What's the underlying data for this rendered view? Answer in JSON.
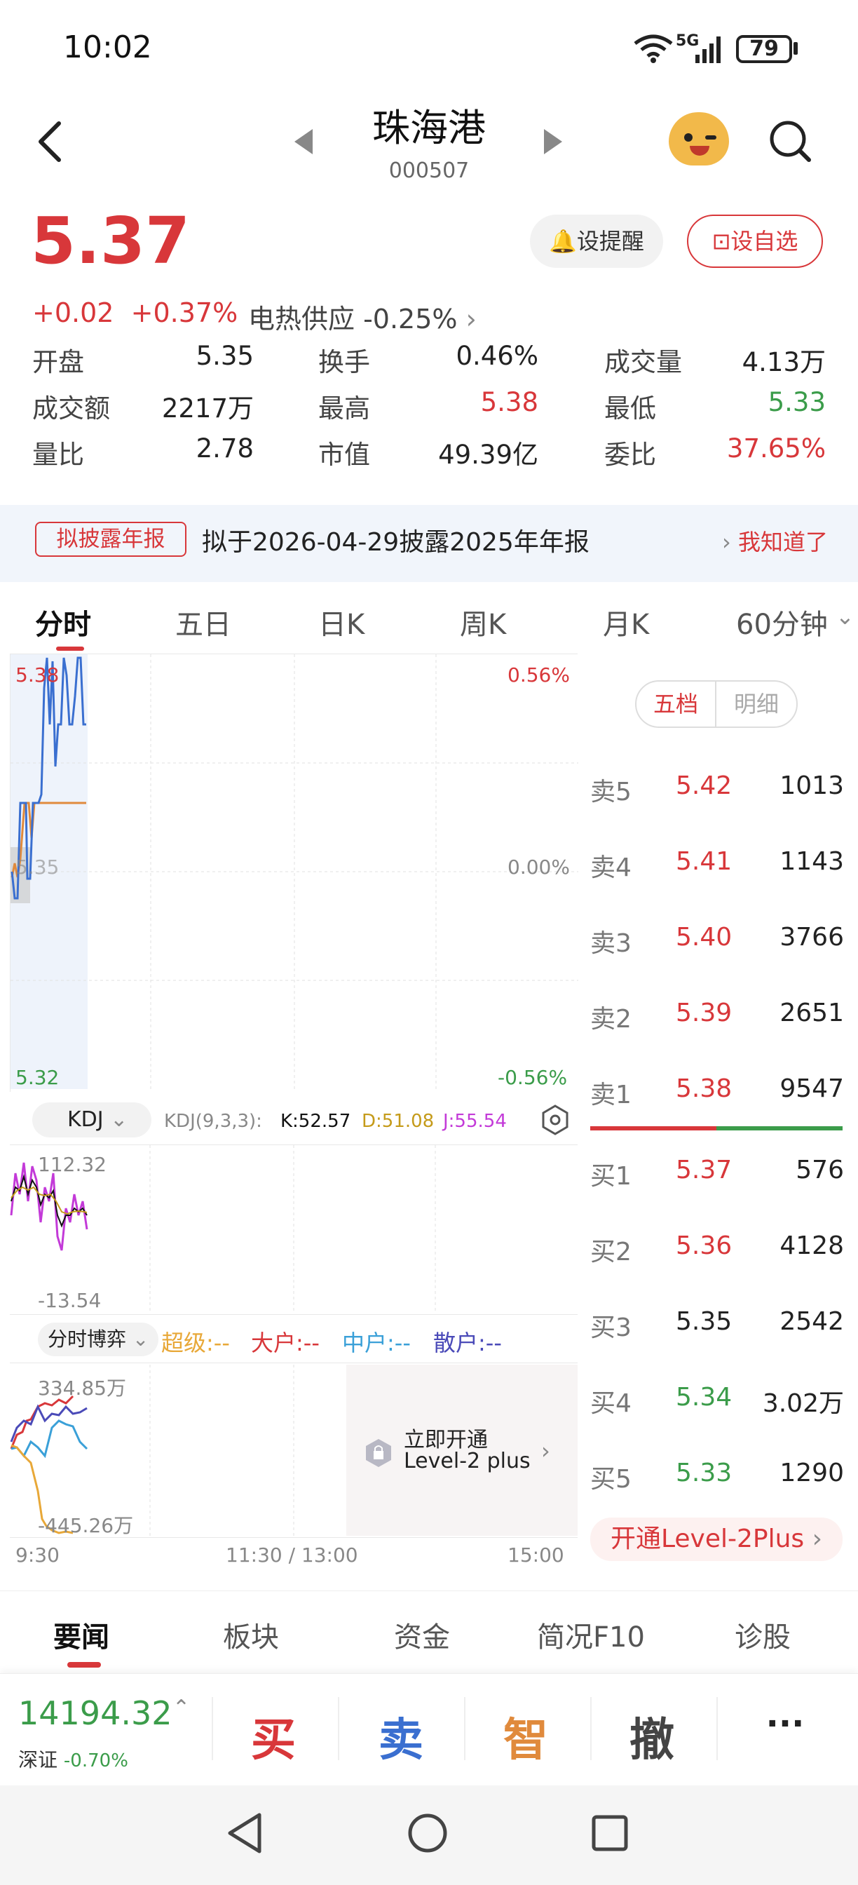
{
  "status": {
    "time": "10:02",
    "network": "5G",
    "battery": "79"
  },
  "header": {
    "name": "珠海港",
    "code": "000507"
  },
  "price": {
    "last": "5.37",
    "change": "+0.02",
    "change_pct": "+0.37%",
    "sector": "电热供应 -0.25%",
    "remind_label": "设提醒",
    "fav_label": "设自选"
  },
  "quotes": [
    {
      "label": "开盘",
      "value": "5.35"
    },
    {
      "label": "换手",
      "value": "0.46%"
    },
    {
      "label": "成交量",
      "value": "4.13万"
    },
    {
      "label": "成交额",
      "value": "2217万"
    },
    {
      "label": "最高",
      "value": "5.38"
    },
    {
      "label": "最低",
      "value": "5.33"
    },
    {
      "label": "量比",
      "value": "2.78"
    },
    {
      "label": "市值",
      "value": "49.39亿"
    },
    {
      "label": "委比",
      "value": "37.65%"
    }
  ],
  "notice": {
    "tag": "拟披露年报",
    "text": "拟于2026-04-29披露2025年年报",
    "action": "我知道了"
  },
  "period_tabs": [
    "分时",
    "五日",
    "日K",
    "周K",
    "月K",
    "60分钟"
  ],
  "chart": {
    "y_top": "5.38",
    "y_mid": "5.35",
    "y_bottom": "5.32",
    "pct_top": "0.56%",
    "pct_mid": "0.00%",
    "pct_bottom": "-0.56%",
    "x_labels": [
      "9:30",
      "11:30 / 13:00",
      "15:00"
    ]
  },
  "kdj": {
    "selector": "KDJ",
    "params": "KDJ(9,3,3):",
    "k": "K:52.57",
    "d": "D:51.08",
    "j": "J:55.54",
    "y_top": "112.32",
    "y_bottom": "-13.54"
  },
  "flow": {
    "selector": "分时博弈",
    "super": "超级:--",
    "large": "大户:--",
    "mid": "中户:--",
    "retail": "散户:--",
    "y_top": "334.85万",
    "y_bottom": "-445.26万",
    "promo_line1": "立即开通",
    "promo_line2": "Level-2 plus"
  },
  "orderbook": {
    "seg_five": "五档",
    "seg_detail": "明细",
    "asks": [
      {
        "label": "卖5",
        "price": "5.42",
        "vol": "1013"
      },
      {
        "label": "卖4",
        "price": "5.41",
        "vol": "1143"
      },
      {
        "label": "卖3",
        "price": "5.40",
        "vol": "3766"
      },
      {
        "label": "卖2",
        "price": "5.39",
        "vol": "2651"
      },
      {
        "label": "卖1",
        "price": "5.38",
        "vol": "9547"
      }
    ],
    "bids": [
      {
        "label": "买1",
        "price": "5.37",
        "vol": "576"
      },
      {
        "label": "买2",
        "price": "5.36",
        "vol": "4128"
      },
      {
        "label": "买3",
        "price": "5.35",
        "vol": "2542"
      },
      {
        "label": "买4",
        "price": "5.34",
        "vol": "3.02万"
      },
      {
        "label": "买5",
        "price": "5.33",
        "vol": "1290"
      }
    ],
    "level2": "开通Level-2Plus"
  },
  "bottom_tabs": [
    "要闻",
    "板块",
    "资金",
    "简况F10",
    "诊股"
  ],
  "index": {
    "value": "14194.32",
    "name": "深证",
    "change": "-0.70%"
  },
  "actions": {
    "buy": "买",
    "sell": "卖",
    "smart": "智",
    "cancel": "撤",
    "more": "···"
  },
  "colors": {
    "up": "#d8373a",
    "down": "#3b9c4a",
    "line": "#3a6fd0",
    "avg": "#e08a3c"
  }
}
